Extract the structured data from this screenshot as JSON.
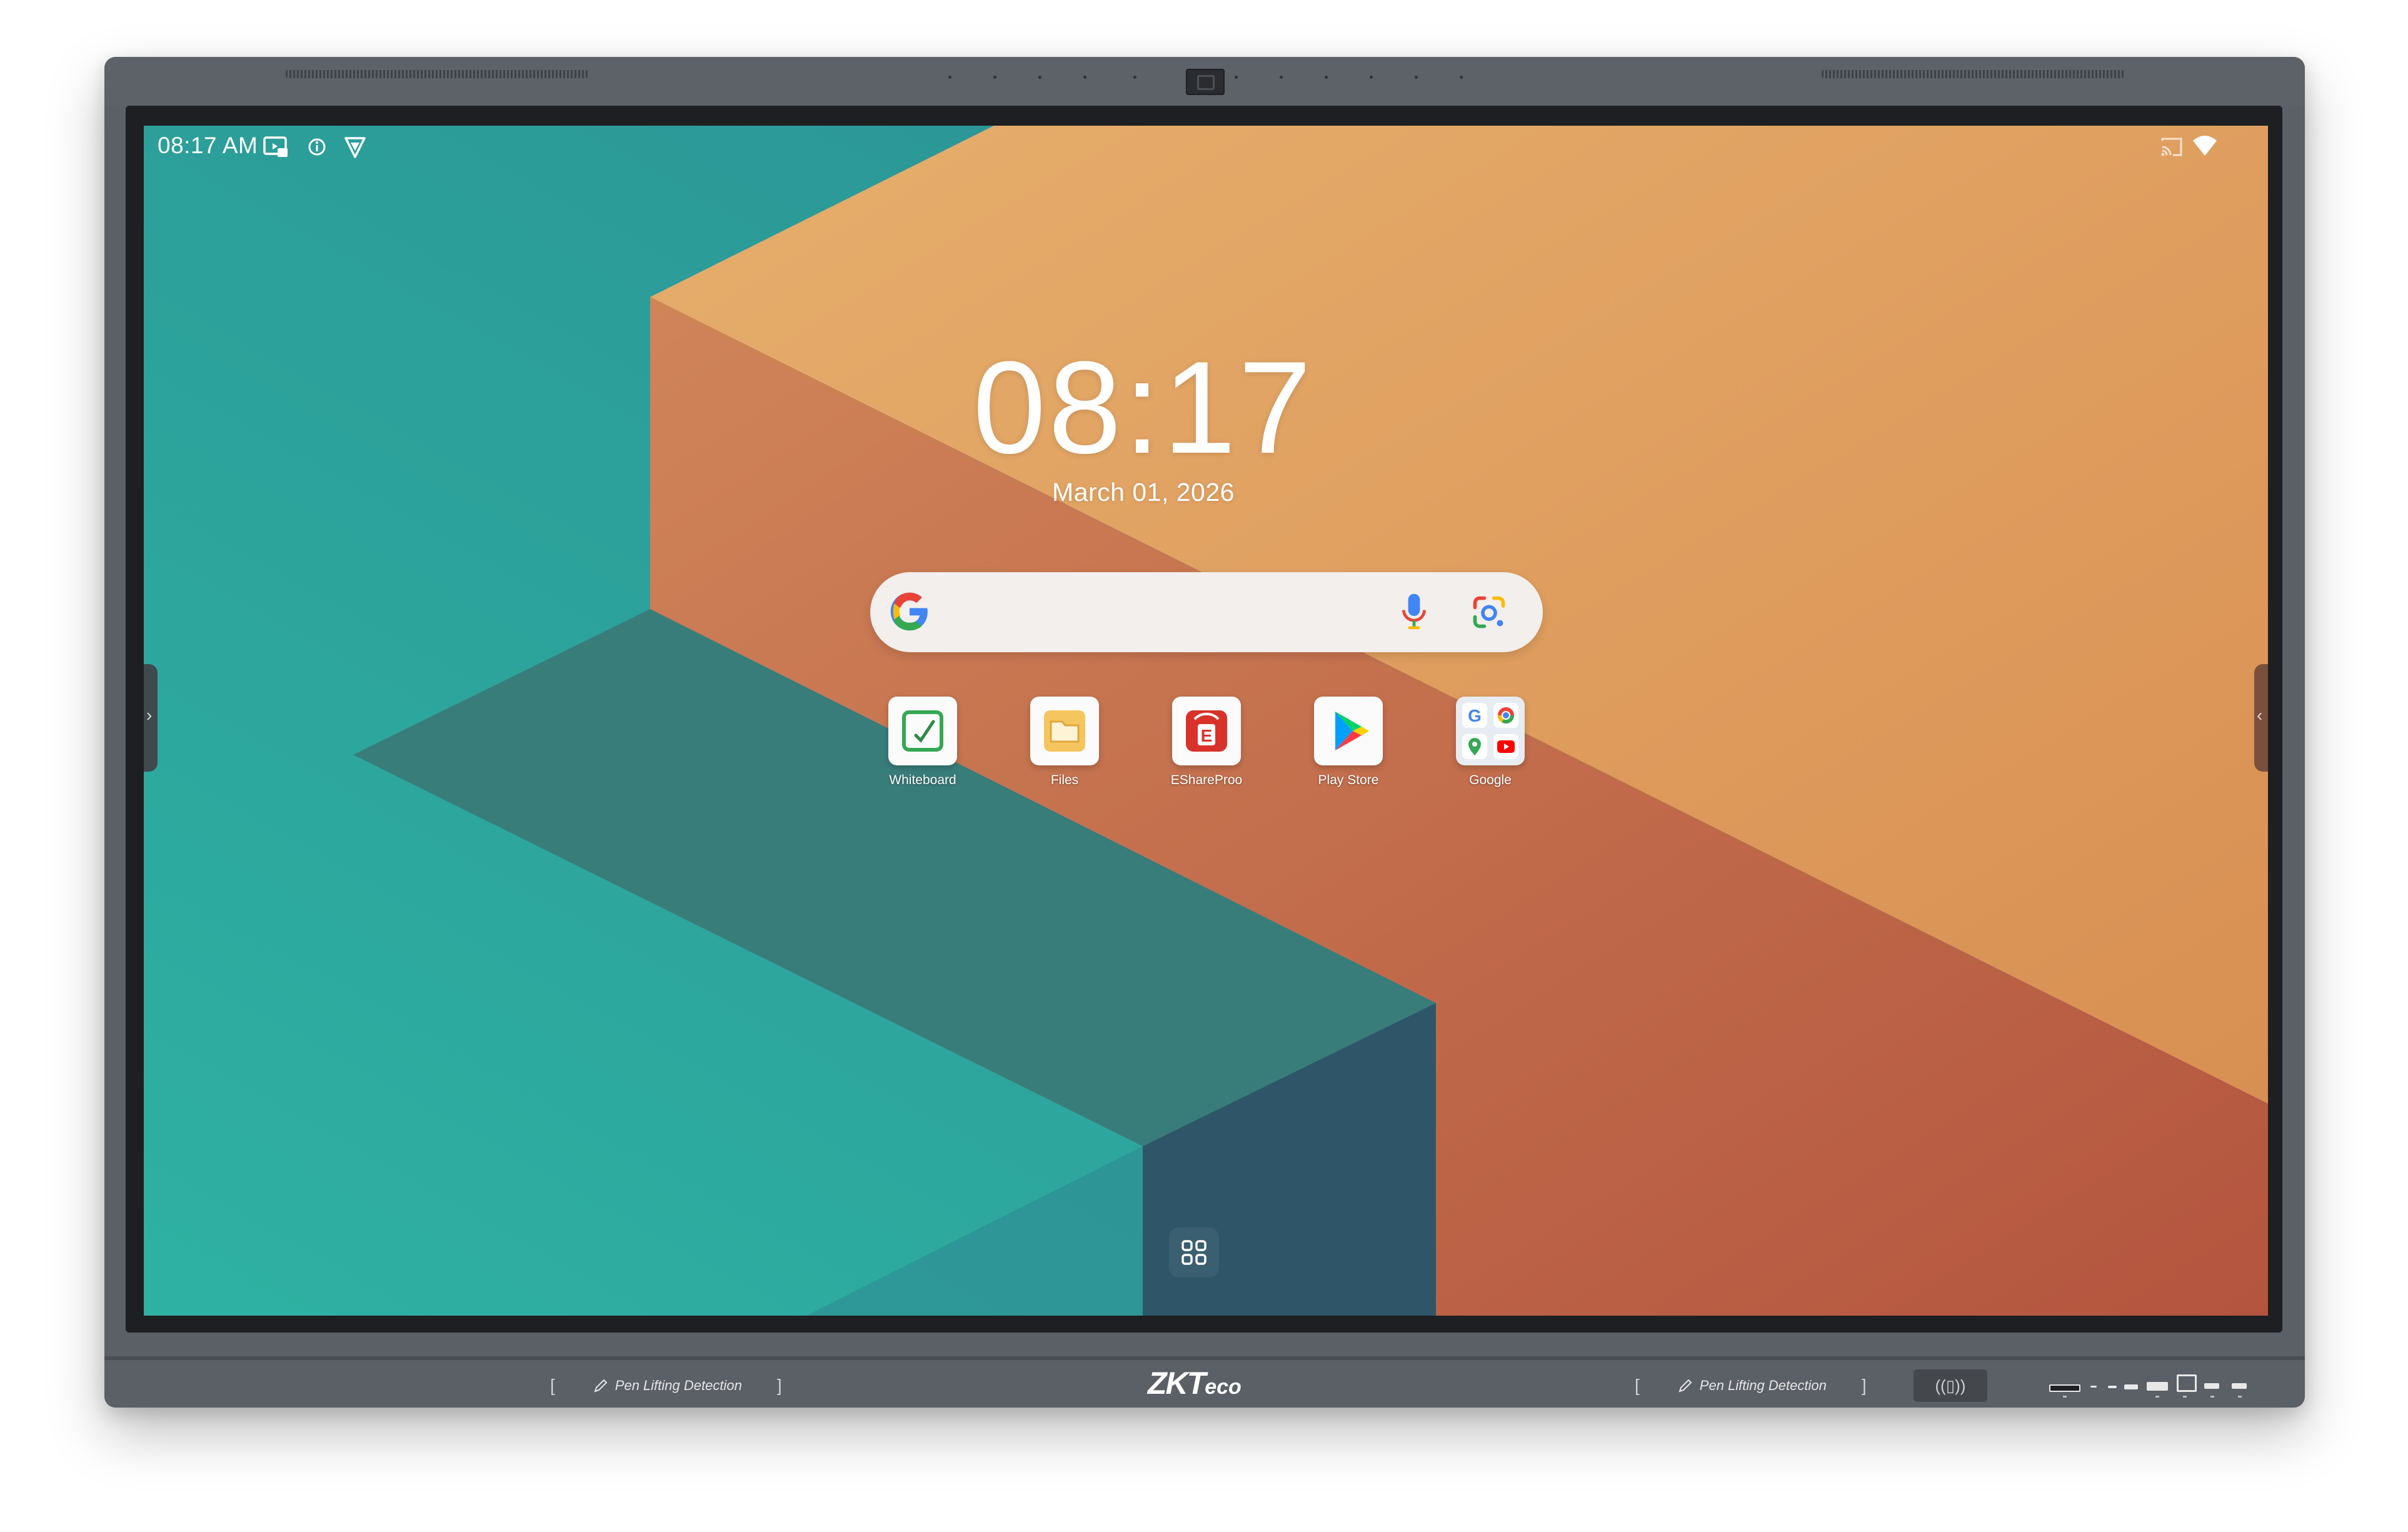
{
  "status_bar": {
    "time": "08:17 AM",
    "left_icons": [
      "screen-share-icon",
      "info-icon",
      "shield-icon"
    ],
    "right_icons": [
      "cast-icon",
      "wifi-icon"
    ]
  },
  "home": {
    "clock": "08:17",
    "date": "March 01, 2026"
  },
  "search": {
    "icons": [
      "google-g-icon",
      "microphone-icon",
      "google-lens-icon"
    ]
  },
  "apps": [
    {
      "label": "Whiteboard",
      "icon": "whiteboard-icon"
    },
    {
      "label": "Files",
      "icon": "files-icon"
    },
    {
      "label": "EShareProo",
      "icon": "eshare-icon"
    },
    {
      "label": "Play Store",
      "icon": "play-store-icon"
    },
    {
      "label": "Google",
      "icon": "google-folder-icon"
    }
  ],
  "dock": {
    "icon": "app-drawer-icon"
  },
  "bezel": {
    "brand_main": "ZKT",
    "brand_sub": "eco",
    "pen_left": "Pen Lifting Detection",
    "pen_right": "Pen Lifting Detection",
    "nfc_symbol": "((▯))"
  },
  "colors": {
    "teal": "#2eab9f",
    "orange": "#e2a867",
    "terracotta": "#c87050",
    "bezel": "#5b5f66"
  }
}
